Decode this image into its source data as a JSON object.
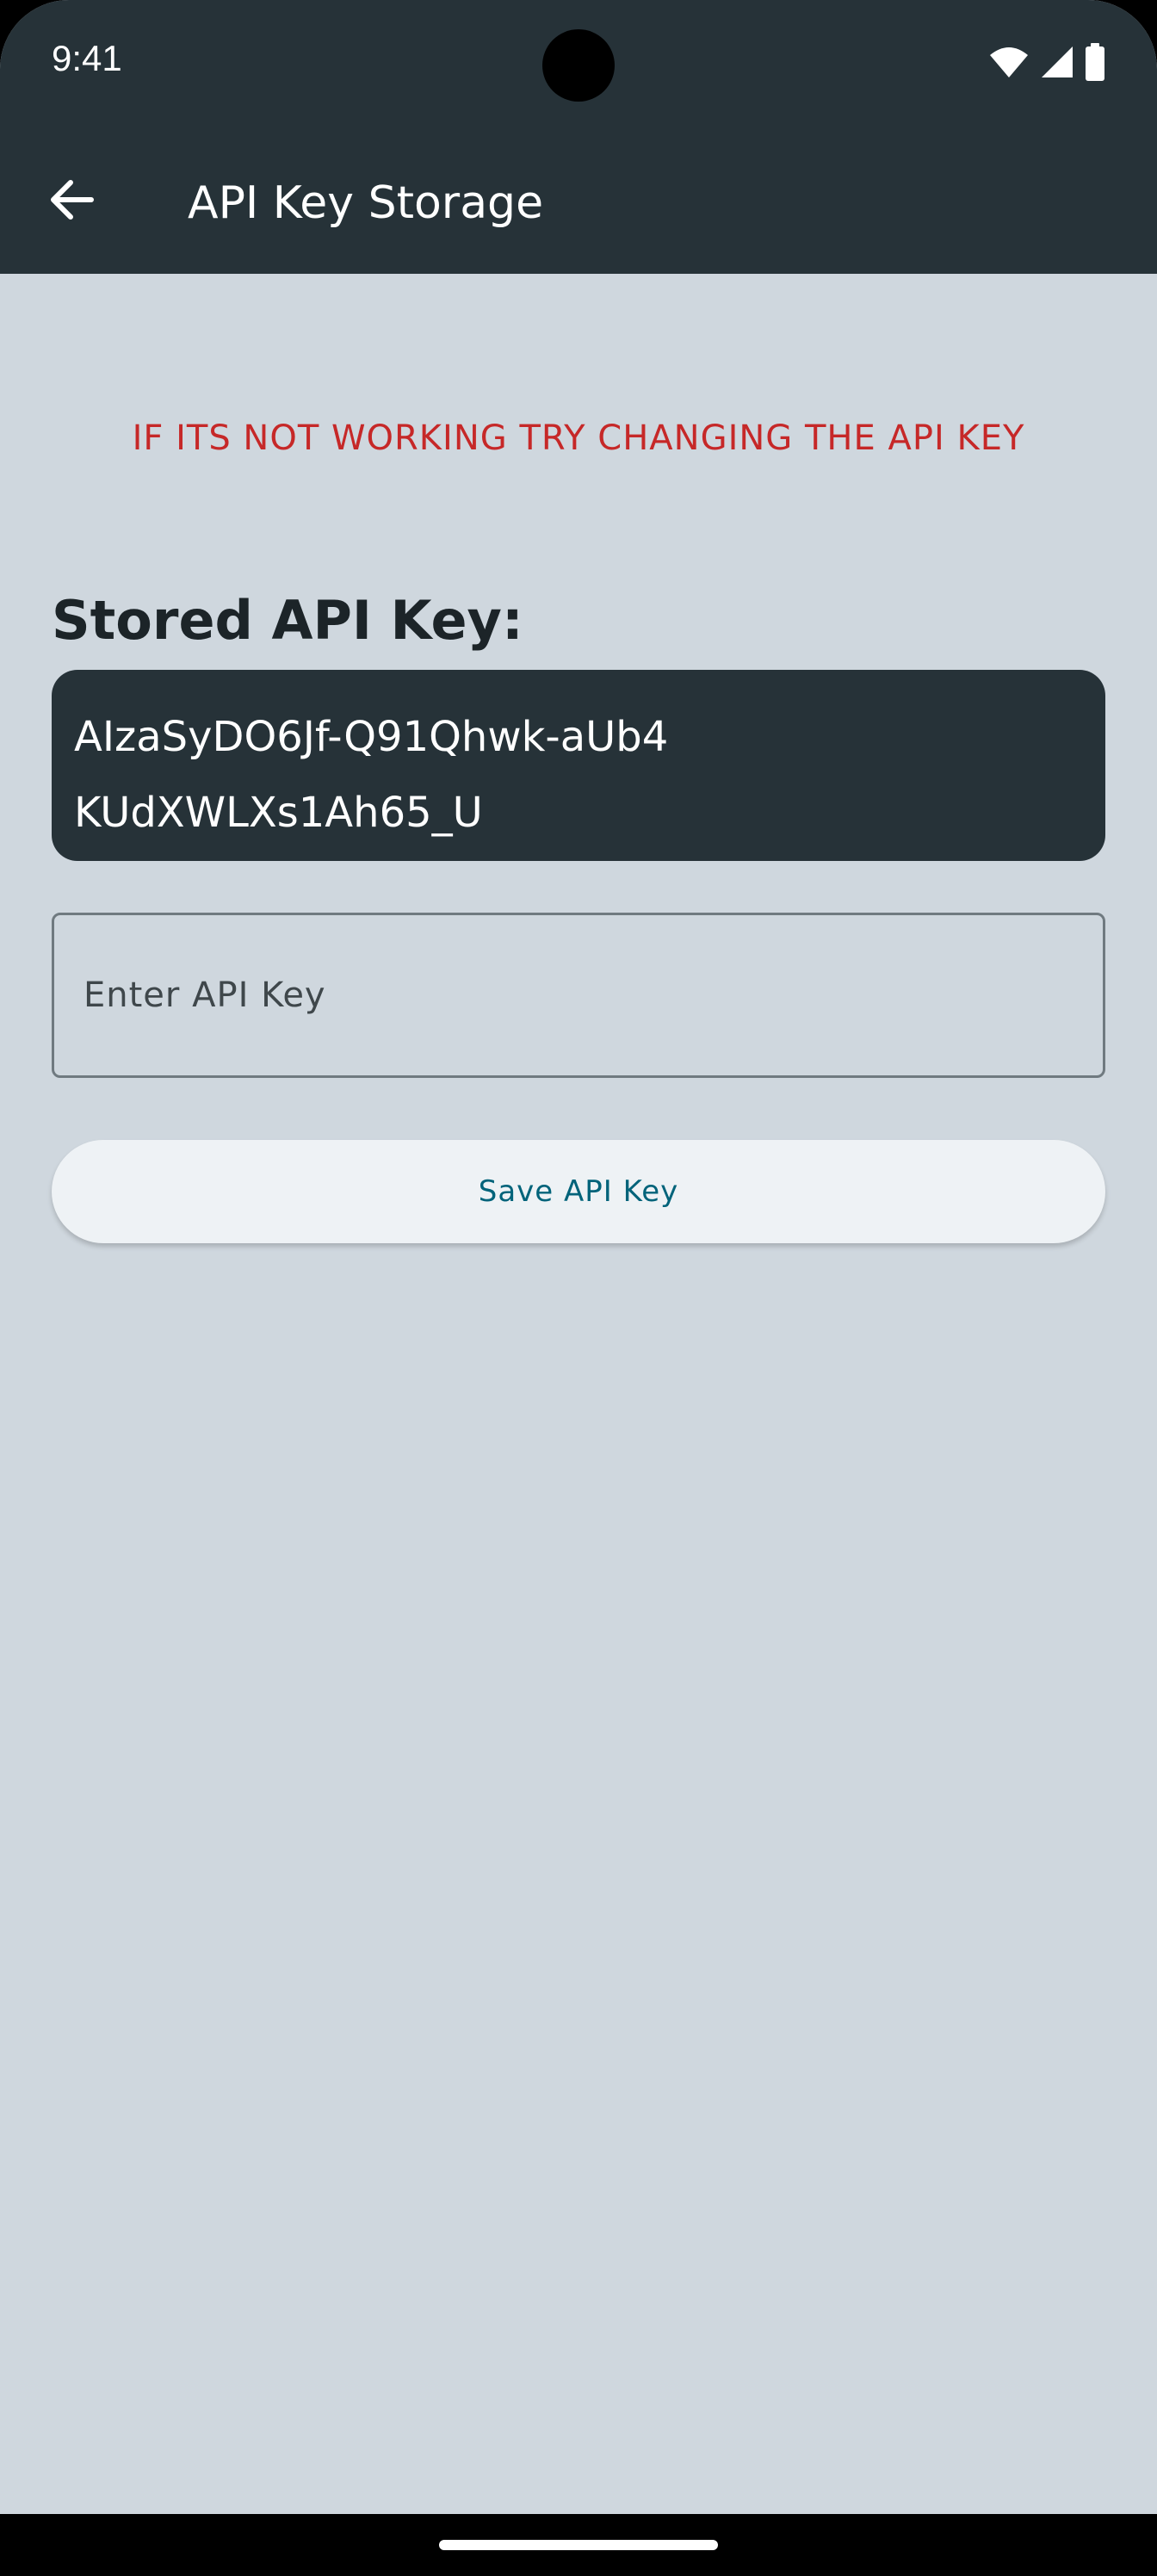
{
  "status_bar": {
    "time": "9:41",
    "icons": [
      "wifi-icon",
      "signal-icon",
      "battery-icon"
    ]
  },
  "app_bar": {
    "back_icon": "arrow-left-icon",
    "title": "API Key Storage"
  },
  "warning": {
    "text": "IF ITS NOT WORKING TRY CHANGING THE API KEY",
    "color": "#c62828"
  },
  "stored_key": {
    "label": "Stored API Key:",
    "value": "AIzaSyDO6Jf-Q91Qhwk-aUb4KUdXWLXs1Ah65_U"
  },
  "api_input": {
    "value": "",
    "placeholder": "Enter API Key"
  },
  "save_button": {
    "label": "Save API Key"
  },
  "colors": {
    "app_bar": "#263238",
    "background": "#cfd7de",
    "button_text": "#00637a"
  }
}
